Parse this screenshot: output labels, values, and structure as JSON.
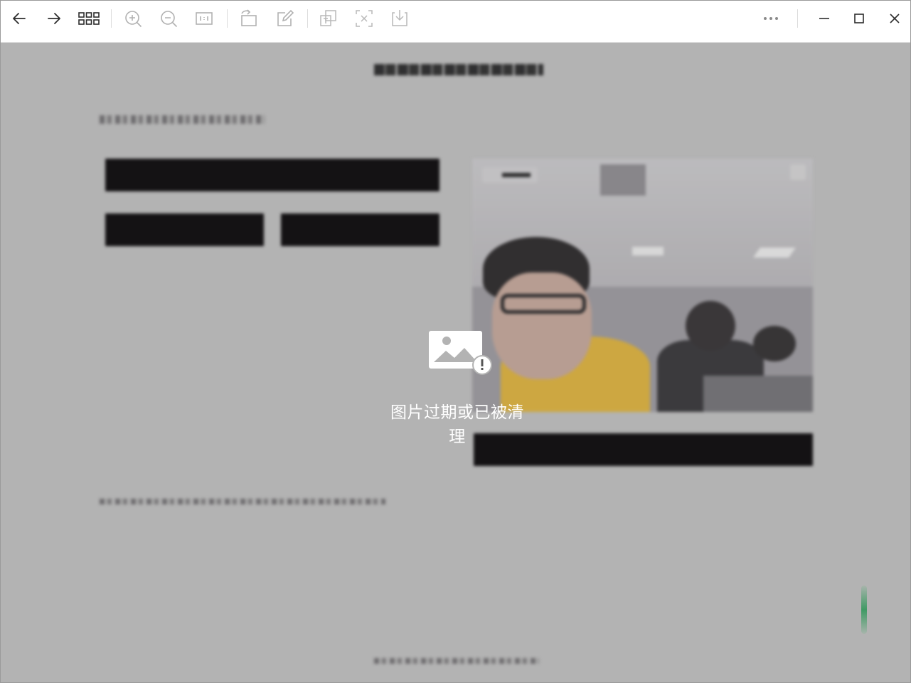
{
  "toolbar": {
    "back_icon": "arrow-left-icon",
    "forward_icon": "arrow-right-icon",
    "grid_icon": "grid-icon",
    "zoom_in_icon": "zoom-in-icon",
    "zoom_out_icon": "zoom-out-icon",
    "actual_size_icon": "actual-size-icon",
    "rotate_icon": "rotate-icon",
    "edit_icon": "edit-icon",
    "translate_icon": "translate-icon",
    "extract_text_icon": "extract-text-icon",
    "download_icon": "download-icon",
    "more_icon": "more-icon",
    "minimize_icon": "minimize-icon",
    "maximize_icon": "maximize-icon",
    "close_icon": "close-icon"
  },
  "overlay": {
    "message": "图片过期或已被清理",
    "icon": "broken-image-icon"
  },
  "colors": {
    "canvas_bg": "#b3b3b3",
    "toolbar_bg": "#ffffff",
    "overlay_text": "#ffffff",
    "scroll_indicator": "#3f9a64"
  }
}
